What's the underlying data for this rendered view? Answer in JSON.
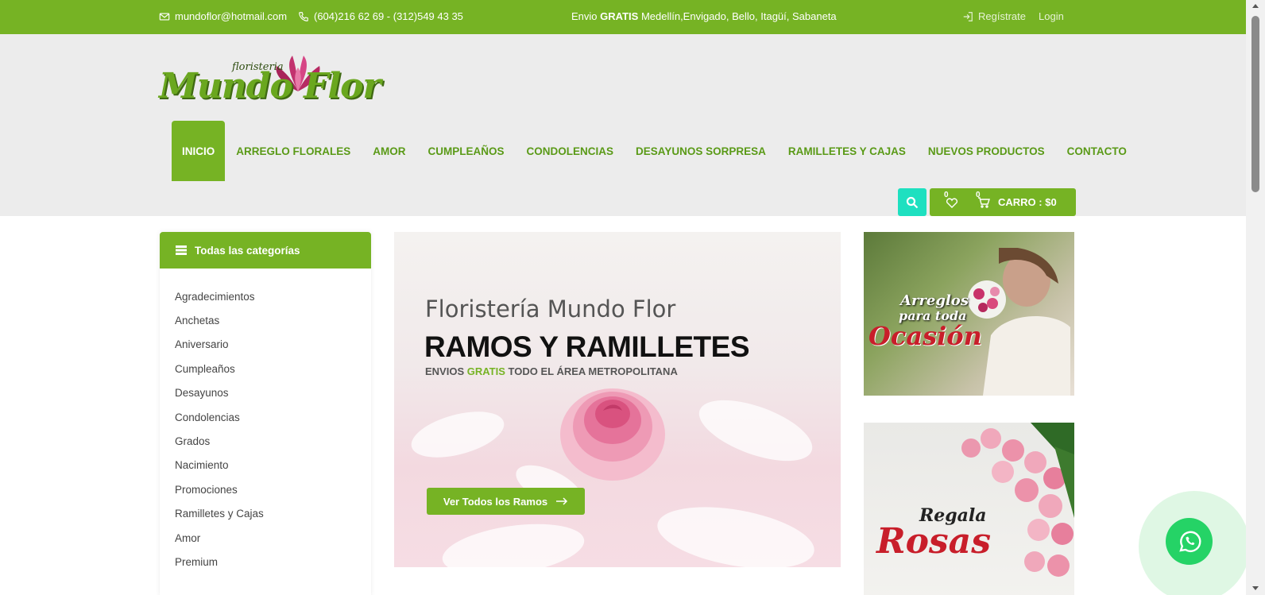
{
  "topbar": {
    "email": "mundoflor@hotmail.com",
    "phones": "(604)216 62 69 - (312)549 43 35",
    "shipping_prefix": "Envio",
    "shipping_bold": "GRATIS",
    "shipping_places": "Medellín,Envigado, Bello, Itagüí, Sabaneta",
    "register": "Regístrate",
    "login": "Login"
  },
  "logo": {
    "subtitle": "floristeria",
    "brand": "Mundo Flor"
  },
  "nav": {
    "items": [
      "INICIO",
      "ARREGLO FLORALES",
      "AMOR",
      "CUMPLEAÑOS",
      "CONDOLENCIAS",
      "DESAYUNOS SORPRESA",
      "RAMILLETES Y CAJAS",
      "NUEVOS PRODUCTOS",
      "CONTACTO"
    ],
    "active": "INICIO"
  },
  "cart": {
    "wishlist_count": "0",
    "cart_count": "0",
    "label": "CARRO : $0"
  },
  "sidebar": {
    "title": "Todas las categorías",
    "categories": [
      "Agradecimientos",
      "Anchetas",
      "Aniversario",
      "Cumpleaños",
      "Desayunos",
      "Condolencias",
      "Grados",
      "Nacimiento",
      "Promociones",
      "Ramilletes y Cajas",
      "Amor",
      "Premium"
    ]
  },
  "hero": {
    "kicker": "Floristería Mundo Flor",
    "title": "RAMOS Y RAMILLETES",
    "sub_prefix": "ENVIOS",
    "sub_highlight": "GRATIS",
    "sub_suffix": "TODO EL ÁREA METROPOLITANA",
    "cta": "Ver Todos los Ramos",
    "cta_icon": "arrow-right-icon"
  },
  "promos": {
    "occasion_line1": "Arreglos",
    "occasion_line2": "para toda",
    "occasion_line3": "Ocasión",
    "roses_line1": "Regala",
    "roses_line2": "Rosas"
  },
  "colors": {
    "brand_green": "#76b324",
    "search_teal": "#1ee0c0",
    "whatsapp": "#25d366"
  }
}
